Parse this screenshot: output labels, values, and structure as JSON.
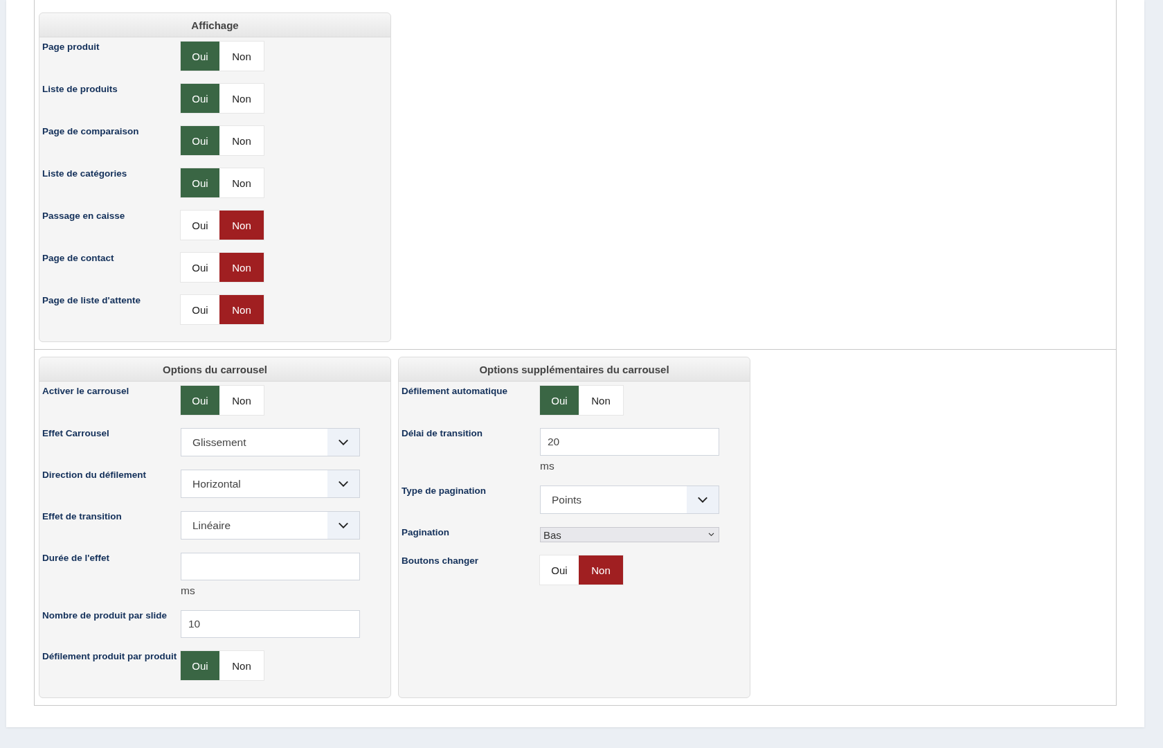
{
  "rows": [
    {
      "panels": [
        {
          "title": "Affichage",
          "fields": [
            {
              "kind": "toggle",
              "label": "Page produit",
              "options": [
                {
                  "label": "Oui",
                  "selected": true
                },
                {
                  "label": "Non",
                  "selected": false
                }
              ]
            },
            {
              "kind": "toggle",
              "label": "Liste de produits",
              "options": [
                {
                  "label": "Oui",
                  "selected": true
                },
                {
                  "label": "Non",
                  "selected": false
                }
              ]
            },
            {
              "kind": "toggle",
              "label": "Page de comparaison",
              "options": [
                {
                  "label": "Oui",
                  "selected": true
                },
                {
                  "label": "Non",
                  "selected": false
                }
              ]
            },
            {
              "kind": "toggle",
              "label": "Liste de catégories",
              "options": [
                {
                  "label": "Oui",
                  "selected": true
                },
                {
                  "label": "Non",
                  "selected": false
                }
              ]
            },
            {
              "kind": "toggle",
              "label": "Passage en caisse",
              "options": [
                {
                  "label": "Oui",
                  "selected": false
                },
                {
                  "label": "Non",
                  "selected": true
                }
              ]
            },
            {
              "kind": "toggle",
              "label": "Page de contact",
              "options": [
                {
                  "label": "Oui",
                  "selected": false
                },
                {
                  "label": "Non",
                  "selected": true
                }
              ]
            },
            {
              "kind": "toggle",
              "label": "Page de liste d'attente",
              "options": [
                {
                  "label": "Oui",
                  "selected": false
                },
                {
                  "label": "Non",
                  "selected": true
                }
              ]
            }
          ]
        }
      ]
    },
    {
      "panels": [
        {
          "title": "Options du carrousel",
          "fields": [
            {
              "kind": "toggle",
              "label": "Activer le carrousel",
              "options": [
                {
                  "label": "Oui",
                  "selected": true
                },
                {
                  "label": "Non",
                  "selected": false
                }
              ]
            },
            {
              "kind": "select",
              "label": "Effet Carrousel",
              "value": "Glissement"
            },
            {
              "kind": "select",
              "label": "Direction du défilement",
              "value": "Horizontal"
            },
            {
              "kind": "select",
              "label": "Effet de transition",
              "value": "Linéaire"
            },
            {
              "kind": "text",
              "label": "Durée de l'effet",
              "unit": "ms"
            },
            {
              "kind": "text",
              "label": "Nombre de produit par slide",
              "value": "10"
            },
            {
              "kind": "toggle",
              "label": "Défilement produit par produit",
              "options": [
                {
                  "label": "Oui",
                  "selected": true
                },
                {
                  "label": "Non",
                  "selected": false
                }
              ]
            }
          ]
        },
        {
          "title": "Options supplémentaires du carrousel",
          "fields": [
            {
              "kind": "toggle",
              "label": "Défilement automatique",
              "options": [
                {
                  "label": "Oui",
                  "selected": true
                },
                {
                  "label": "Non",
                  "selected": false
                }
              ]
            },
            {
              "kind": "text",
              "label": "Délai de transition",
              "value": "20",
              "unit": "ms"
            },
            {
              "kind": "select",
              "label": "Type de pagination",
              "value": "Points"
            },
            {
              "kind": "native-select",
              "label": "Pagination",
              "value": "Bas"
            },
            {
              "kind": "toggle",
              "label": "Boutons changer",
              "options": [
                {
                  "label": "Oui",
                  "selected": false
                },
                {
                  "label": "Non",
                  "selected": true
                }
              ]
            }
          ]
        }
      ]
    }
  ]
}
